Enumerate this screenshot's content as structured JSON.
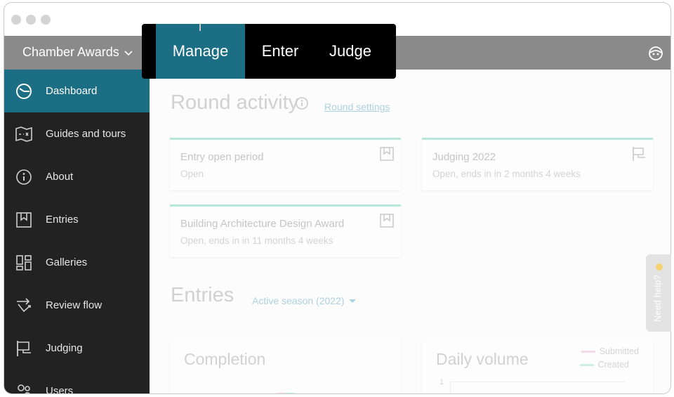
{
  "app": {
    "brand": "Chamber Awards"
  },
  "mode_switch": {
    "tabs": [
      "Manage",
      "Enter",
      "Judge"
    ],
    "active": "Manage"
  },
  "sidebar": {
    "items": [
      {
        "label": "Dashboard",
        "icon": "dashboard-icon",
        "active": true
      },
      {
        "label": "Guides and tours",
        "icon": "map-icon"
      },
      {
        "label": "About",
        "icon": "info-icon"
      },
      {
        "label": "Entries",
        "icon": "bookmark-icon"
      },
      {
        "label": "Galleries",
        "icon": "grid-icon"
      },
      {
        "label": "Review flow",
        "icon": "review-flow-icon"
      },
      {
        "label": "Judging",
        "icon": "flag-icon"
      },
      {
        "label": "Users",
        "icon": "users-icon"
      }
    ]
  },
  "round_activity": {
    "title": "Round activity",
    "settings_link": "Round settings",
    "cards": [
      {
        "title": "Entry open period",
        "status": "Open",
        "icon": "bookmark-icon"
      },
      {
        "title": "Judging 2022",
        "status": "Open, ends in in 2 months 4 weeks",
        "icon": "flag-icon"
      },
      {
        "title": "Building Architecture Design Award",
        "status": "Open, ends in in 11 months 4 weeks",
        "icon": "bookmark-icon"
      }
    ]
  },
  "entries": {
    "title": "Entries",
    "season_select": "Active season (2022)",
    "panels": {
      "completion": {
        "title": "Completion"
      },
      "daily_volume": {
        "title": "Daily volume",
        "y_tick": "1",
        "legend": [
          {
            "label": "Submitted",
            "color": "#e5a1be"
          },
          {
            "label": "Created",
            "color": "#7fd7c8"
          }
        ]
      }
    }
  },
  "help_tab": {
    "label": "Need help?"
  },
  "colors": {
    "accent": "#1b6e84",
    "sidebar_bg": "#222222",
    "topbar_bg": "#8a8a8a",
    "card_border": "#47c9a5"
  }
}
